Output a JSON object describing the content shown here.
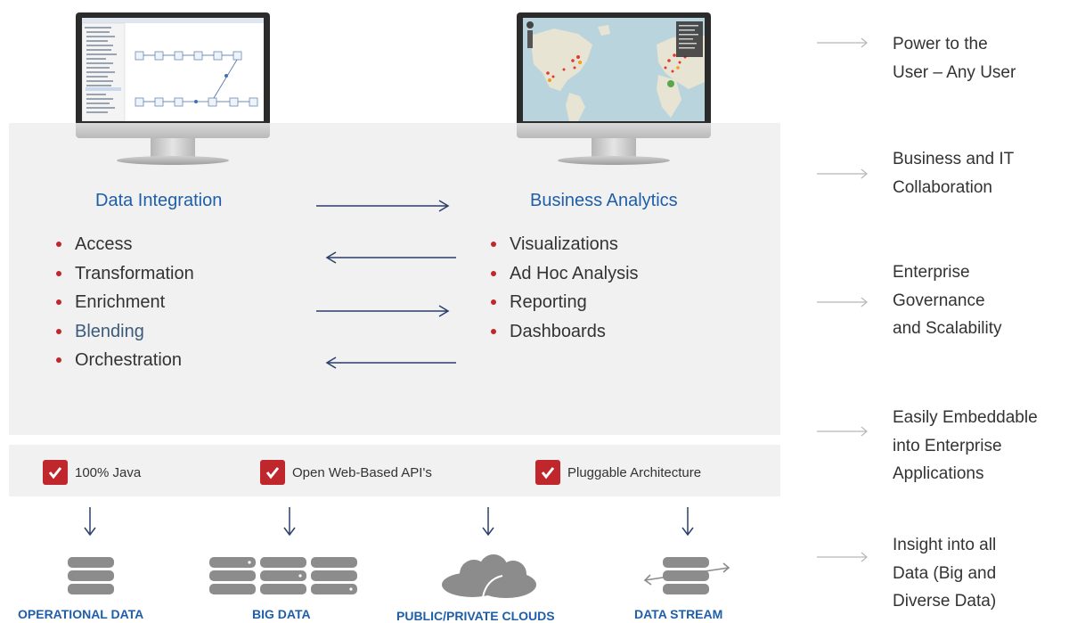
{
  "left_column": {
    "heading": "Data Integration",
    "items": [
      "Access",
      "Transformation",
      "Enrichment",
      "Blending",
      "Orchestration"
    ]
  },
  "right_column": {
    "heading": "Business Analytics",
    "items": [
      "Visualizations",
      "Ad Hoc Analysis",
      "Reporting",
      "Dashboards"
    ]
  },
  "features": [
    "100% Java",
    "Open Web-Based API's",
    "Pluggable Architecture"
  ],
  "sources": [
    "OPERATIONAL DATA",
    "BIG DATA",
    "PUBLIC/PRIVATE CLOUDS",
    "DATA STREAM"
  ],
  "benefits": [
    [
      "Power to the",
      "User – Any User"
    ],
    [
      "Business and IT",
      "Collaboration"
    ],
    [
      "Enterprise",
      "Governance",
      "and Scalability"
    ],
    [
      "Easily Embeddable",
      "into Enterprise",
      "Applications"
    ],
    [
      "Insight into all",
      "Data (Big and",
      "Diverse Data)"
    ]
  ],
  "colors": {
    "heading_blue": "#1f5ea8",
    "bullet_red": "#c0272d",
    "blending_text": "#3d5a7a",
    "panel_gray": "#f1f1f1",
    "arrow_navy": "#2a3f6b",
    "icon_gray": "#8c8c8c"
  }
}
